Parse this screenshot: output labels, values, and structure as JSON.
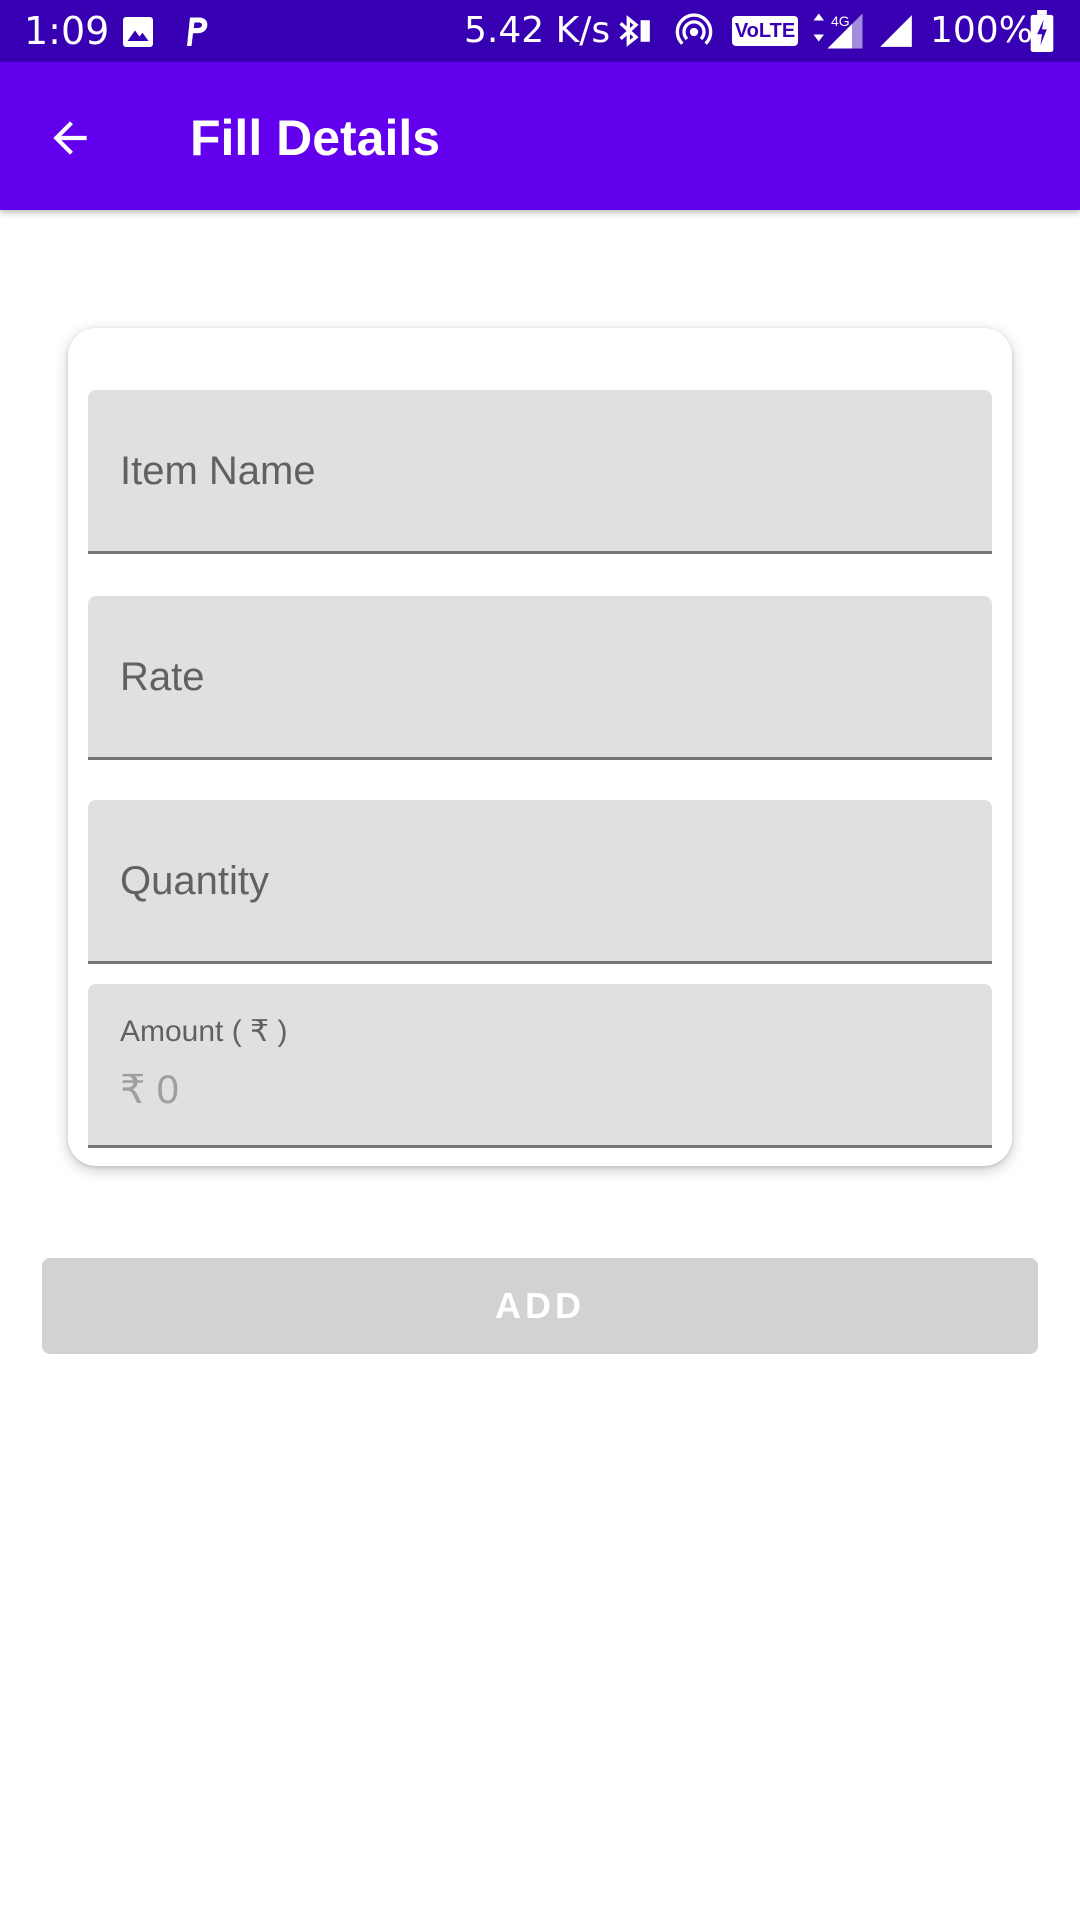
{
  "status_bar": {
    "time": "1:09",
    "network_speed": "5.42 K/s",
    "volte": "VoLTE",
    "network_type": "4G",
    "battery": "100%",
    "icons": [
      "image-icon",
      "p-app-icon",
      "bluetooth-icon",
      "hotspot-icon",
      "volte-icon",
      "signal-4g-icon",
      "signal-icon",
      "battery-charging-icon"
    ]
  },
  "app_bar": {
    "title": "Fill Details",
    "back_icon": "arrow-back-icon",
    "color": "#6200ee"
  },
  "form": {
    "item_name": {
      "placeholder": "Item Name",
      "value": ""
    },
    "rate": {
      "placeholder": "Rate",
      "value": ""
    },
    "quantity": {
      "placeholder": "Quantity",
      "value": ""
    },
    "amount": {
      "label": "Amount ( ₹ )",
      "value": "₹ 0"
    }
  },
  "add_button": {
    "label": "ADD",
    "enabled": false
  }
}
